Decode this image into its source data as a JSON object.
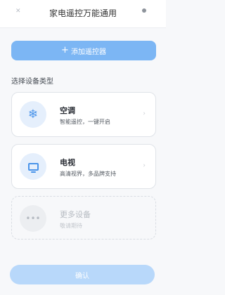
{
  "header": {
    "title": "家电遥控万能通用",
    "left_icon": "back-icon",
    "right_icon": "more-dot-icon"
  },
  "add_button": {
    "label": "添加遥控器",
    "icon": "plus-icon"
  },
  "section_title": "选择设备类型",
  "devices": [
    {
      "name": "空调",
      "desc": "智能遥控，一键开启",
      "icon": "snowflake-icon",
      "icon_glyph": "❄"
    },
    {
      "name": "电视",
      "desc": "高清视界，多品牌支持",
      "icon": "tv-icon"
    },
    {
      "name": "更多设备",
      "desc": "敬请期待",
      "icon": "more-icon",
      "icon_glyph": "•••"
    }
  ],
  "confirm_button": {
    "label": "确认"
  },
  "colors": {
    "accent": "#7cb6f4",
    "accent_light": "#b8d8fa",
    "icon_blue": "#4a94ea"
  }
}
